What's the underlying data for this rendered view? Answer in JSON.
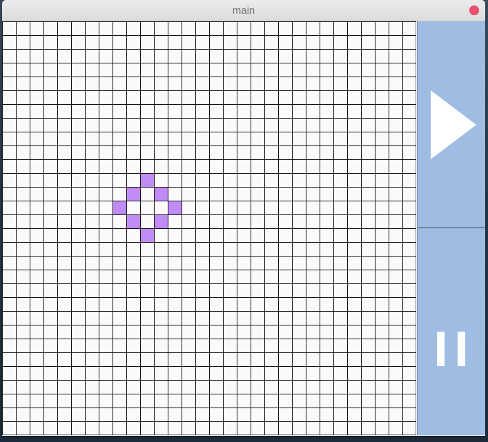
{
  "window": {
    "title": "main"
  },
  "grid": {
    "columns": 30,
    "rows": 30,
    "cell_color": "#fafafa",
    "line_color": "#111111",
    "alive_color": "#c08bf5",
    "alive_cells": [
      {
        "col": 10,
        "row": 11
      },
      {
        "col": 9,
        "row": 12
      },
      {
        "col": 11,
        "row": 12
      },
      {
        "col": 8,
        "row": 13
      },
      {
        "col": 12,
        "row": 13
      },
      {
        "col": 9,
        "row": 14
      },
      {
        "col": 11,
        "row": 14
      },
      {
        "col": 10,
        "row": 15
      }
    ]
  },
  "controls": {
    "panel_color": "#9fbde3",
    "play_icon": "play-icon",
    "pause_icon": "pause-icon"
  }
}
